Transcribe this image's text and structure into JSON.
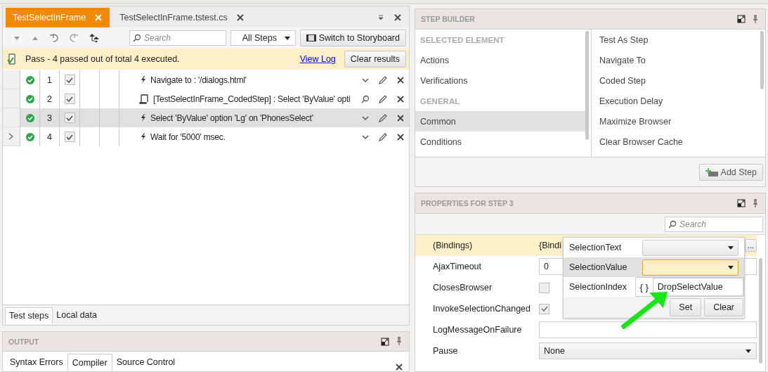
{
  "editor_tabs": [
    {
      "label": "TestSelectInFrame",
      "selected": true
    },
    {
      "label": "TestSelectInFrame.tstest.cs",
      "selected": false
    }
  ],
  "toolbar": {
    "search": {
      "placeholder": "Search"
    },
    "filter": "All Steps",
    "storyboard_button": "Switch to Storyboard"
  },
  "result_bar": {
    "message": "Pass - 4 passed out of total 4 executed.",
    "link": "View Log",
    "button": "Clear results"
  },
  "steps": [
    {
      "number": "1",
      "kind": "action",
      "passed": true,
      "enabled": true,
      "selected": false,
      "current": false,
      "description": "Navigate to : '/dialogs.html'"
    },
    {
      "number": "2",
      "kind": "coded",
      "passed": true,
      "enabled": true,
      "selected": false,
      "current": false,
      "description": "[TestSelectInFrame_CodedStep] : Select 'ByValue' opti"
    },
    {
      "number": "3",
      "kind": "action",
      "passed": true,
      "enabled": true,
      "selected": true,
      "current": false,
      "description": "Select 'ByValue' option 'Lg' on 'PhonesSelect'"
    },
    {
      "number": "4",
      "kind": "action",
      "passed": true,
      "enabled": true,
      "selected": false,
      "current": true,
      "description": "Wait for '5000' msec."
    }
  ],
  "bottom_tabs": [
    {
      "label": "Test steps",
      "selected": true
    },
    {
      "label": "Local data",
      "selected": false
    }
  ],
  "output": {
    "title": "OUTPUT",
    "tabs": [
      {
        "label": "Syntax Errors",
        "selected": false
      },
      {
        "label": "Compiler",
        "selected": true
      },
      {
        "label": "Source Control",
        "selected": false
      }
    ]
  },
  "step_builder": {
    "title": "STEP BUILDER",
    "categories": [
      {
        "label": "SELECTED ELEMENT",
        "kind": "header"
      },
      {
        "label": "Actions",
        "kind": "item",
        "selected": false
      },
      {
        "label": "Verifications",
        "kind": "item",
        "selected": false
      },
      {
        "label": "GENERAL",
        "kind": "header"
      },
      {
        "label": "Common",
        "kind": "item",
        "selected": true
      },
      {
        "label": "Conditions",
        "kind": "item",
        "selected": false
      }
    ],
    "items": [
      "Test As Step",
      "Navigate To",
      "Coded Step",
      "Execution Delay",
      "Maximize Browser",
      "Clear Browser Cache"
    ],
    "button": "Add Step"
  },
  "properties": {
    "title": "PROPERTIES FOR STEP 3",
    "search": {
      "placeholder": "Search"
    },
    "rows": [
      {
        "name": "(Bindings)",
        "kind": "binding",
        "value": "{Bindi",
        "button": "...",
        "highlighted": true
      },
      {
        "name": "AjaxTimeout",
        "kind": "text",
        "value": "0",
        "highlighted": false
      },
      {
        "name": "ClosesBrowser",
        "kind": "checkbox",
        "checked": false,
        "highlighted": false
      },
      {
        "name": "InvokeSelectionChanged",
        "kind": "checkbox",
        "checked": true,
        "highlighted": false
      },
      {
        "name": "LogMessageOnFailure",
        "kind": "text",
        "highlighted": false
      },
      {
        "name": "Pause",
        "kind": "dropdown",
        "value": "None",
        "highlighted": false
      }
    ]
  },
  "bindings_popup": {
    "rows": [
      {
        "name": "SelectionText",
        "kind": "dropdown",
        "selected": false
      },
      {
        "name": "SelectionValue",
        "kind": "dropdown",
        "selected": true
      },
      {
        "name": "SelectionIndex",
        "kind": "variable",
        "icon": "{ }",
        "value": "DropSelectValue",
        "selected": false
      }
    ],
    "buttons": [
      "Set",
      "Clear"
    ]
  }
}
